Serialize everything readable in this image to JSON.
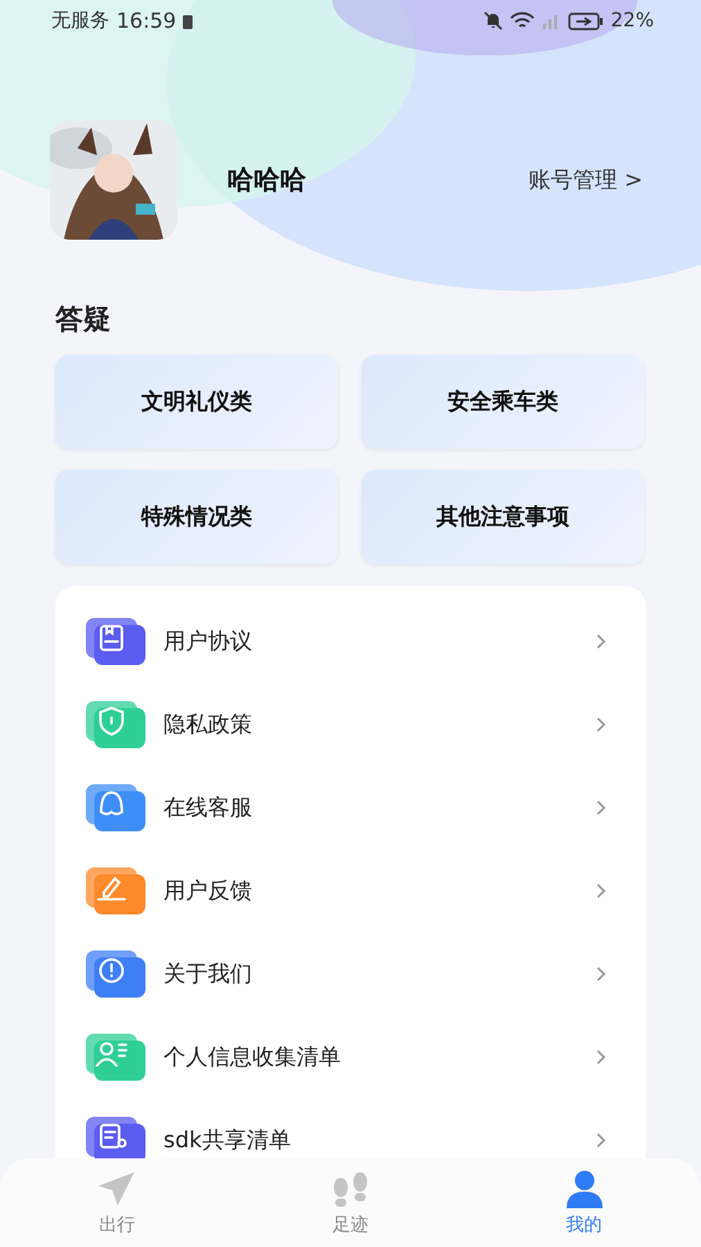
{
  "status_bar": {
    "carrier": "无服务",
    "time": "16:59",
    "battery": "22%"
  },
  "profile": {
    "name": "哈哈哈",
    "account_link": "账号管理 >"
  },
  "faq": {
    "title": "答疑",
    "categories": [
      "文明礼仪类",
      "安全乘车类",
      "特殊情况类",
      "其他注意事项"
    ]
  },
  "menu": [
    {
      "label": "用户协议",
      "kind": "doc",
      "color": "#5b5cf0"
    },
    {
      "label": "隐私政策",
      "kind": "shield",
      "color": "#2fcf96"
    },
    {
      "label": "在线客服",
      "kind": "chat",
      "color": "#3f8ef7"
    },
    {
      "label": "用户反馈",
      "kind": "pen",
      "color": "#ff8a2c"
    },
    {
      "label": "关于我们",
      "kind": "info",
      "color": "#3f7ff5"
    },
    {
      "label": "个人信息收集清单",
      "kind": "person",
      "color": "#2fcf96"
    },
    {
      "label": "sdk共享清单",
      "kind": "list",
      "color": "#5b5cf0"
    }
  ],
  "tabs": [
    {
      "label": "出行",
      "kind": "plane",
      "selected": false
    },
    {
      "label": "足迹",
      "kind": "steps",
      "selected": false
    },
    {
      "label": "我的",
      "kind": "user",
      "selected": true
    }
  ]
}
